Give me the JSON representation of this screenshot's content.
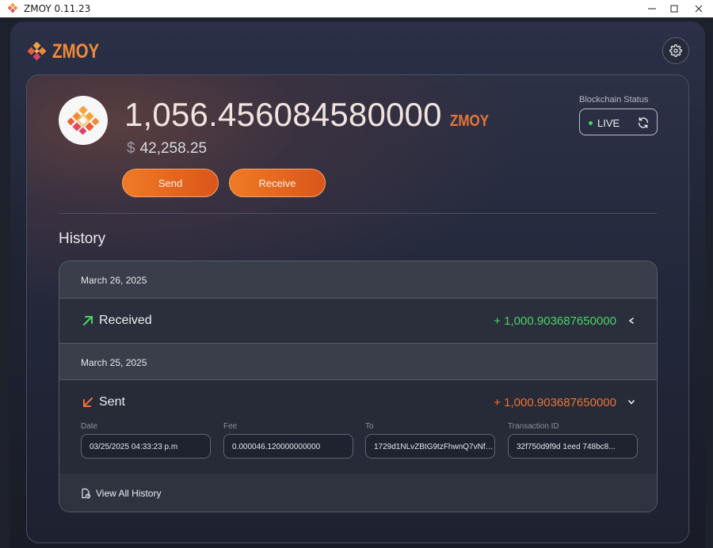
{
  "window": {
    "title": "ZMOY 0.11.23",
    "icon": "zmoy-logo-icon",
    "controls": {
      "minimize": "—",
      "maximize": "☐",
      "close": "✕"
    }
  },
  "header": {
    "brand": "ZMOY",
    "settings_icon": "gear-icon"
  },
  "wallet": {
    "balance": "1,056.456084580000",
    "ticker": "ZMOY",
    "fiat_symbol": "$",
    "fiat_value": "42,258.25",
    "send_label": "Send",
    "receive_label": "Receive"
  },
  "blockchain": {
    "status_label": "Blockchain Status",
    "status_value": "LIVE",
    "status_color": "#49d35a",
    "refresh_icon": "refresh-icon"
  },
  "history": {
    "title": "History",
    "groups": [
      {
        "date": "March 26, 2025",
        "transaction": {
          "type": "Received",
          "amount": "+ 1,000.903687650000",
          "color": "#4ad26a",
          "icon": "arrow-up-right-icon",
          "expanded": false
        }
      },
      {
        "date": "March 25, 2025",
        "transaction": {
          "type": "Sent",
          "amount": "+ 1,000.903687650000",
          "color": "#ec7434",
          "icon": "arrow-down-left-icon",
          "expanded": true,
          "details": {
            "date_label": "Date",
            "date_value": "03/25/2025 04:33:23 p.m",
            "fee_label": "Fee",
            "fee_value": "0.000046.120000000000",
            "to_label": "To",
            "to_value": "1729d1NLvZBtG9tzFhwnQ7vNfc...",
            "txid_label": "Transaction ID",
            "txid_value": "32f750d9f9d 1eed 748bc8..."
          }
        }
      }
    ],
    "view_all_label": "View All History"
  },
  "colors": {
    "accent": "#f07a25",
    "brand_orange": "#f28a3b",
    "received": "#4ad26a",
    "sent": "#ec7434"
  }
}
